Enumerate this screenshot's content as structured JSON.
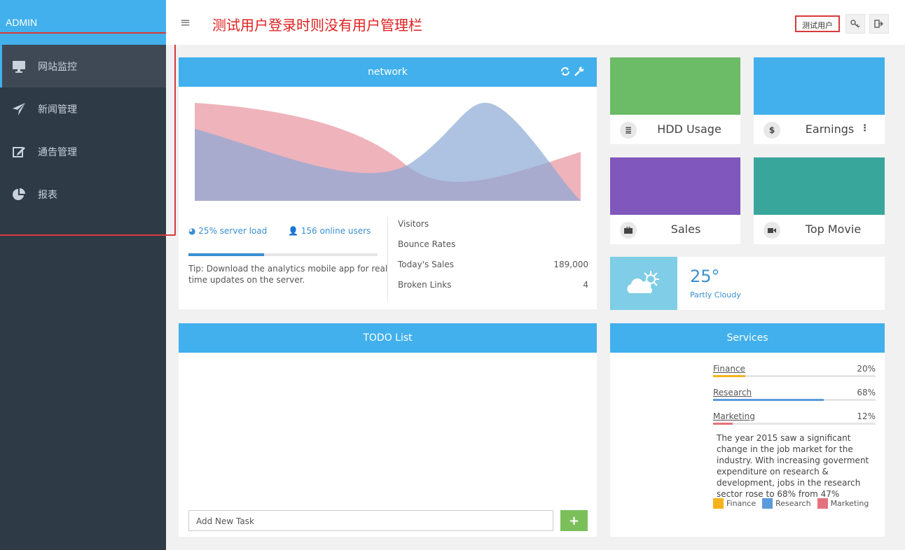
{
  "brand": "ADMIN",
  "sidebar": {
    "items": [
      {
        "label": "网站监控",
        "icon": "monitor-icon"
      },
      {
        "label": "新闻管理",
        "icon": "paper-plane-icon"
      },
      {
        "label": "通告管理",
        "icon": "edit-icon"
      },
      {
        "label": "报表",
        "icon": "pie-chart-icon"
      }
    ]
  },
  "header": {
    "title": "测试用户登录时则没有用户管理栏",
    "user_label": "测试用户",
    "key_icon": "key-icon",
    "logout_icon": "logout-icon"
  },
  "network": {
    "title": "network",
    "server_load": "25% server load",
    "online_users": "156 online users",
    "server_load_fraction": 0.4,
    "tip": "Tip: Download the analytics mobile app for real time updates on the server.",
    "metrics": [
      {
        "label": "Visitors",
        "value": ""
      },
      {
        "label": "Bounce Rates",
        "value": ""
      },
      {
        "label": "Today's Sales",
        "value": "189,000"
      },
      {
        "label": "Broken Links",
        "value": "4"
      }
    ],
    "colors": {
      "pink": "#e99aa4",
      "blue": "#8ba8d6"
    }
  },
  "tiles": [
    {
      "label": "HDD Usage",
      "color": "#6cbb66",
      "icon": "database-icon"
    },
    {
      "label": "Earnings",
      "color": "#41b0ec",
      "icon": "dollar-icon"
    },
    {
      "label": "Sales",
      "color": "#7f57bd",
      "icon": "briefcase-icon"
    },
    {
      "label": "Top Movie",
      "color": "#39a69b",
      "icon": "video-camera-icon"
    }
  ],
  "weather": {
    "temp": "25°",
    "condition": "Partly Cloudy"
  },
  "todo": {
    "title": "TODO List",
    "placeholder": "Add New Task",
    "add_label": "+"
  },
  "services": {
    "title": "Services",
    "items": [
      {
        "name": "Finance",
        "percent": "20%",
        "value": 0.2,
        "color": "#f5b21b"
      },
      {
        "name": "Research",
        "percent": "68%",
        "value": 0.68,
        "color": "#5b9bdc"
      },
      {
        "name": "Marketing",
        "percent": "12%",
        "value": 0.12,
        "color": "#e4727d"
      }
    ],
    "text": "The year 2015 saw a significant change in the job market for the industry. With increasing goverment expenditure on research & development, jobs in the research sector rose to 68% from 47%",
    "legend": [
      "Finance",
      "Research",
      "Marketing"
    ]
  }
}
